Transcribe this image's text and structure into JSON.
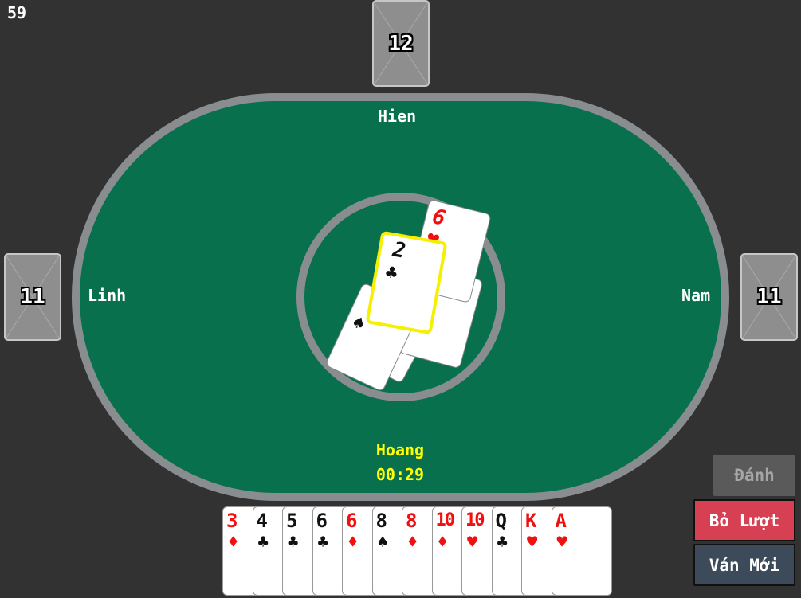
{
  "counter": "59",
  "players": {
    "top": {
      "name": "Hien",
      "cards_left": "12"
    },
    "left": {
      "name": "Linh",
      "cards_left": "11"
    },
    "right": {
      "name": "Nam",
      "cards_left": "11"
    },
    "bottom": {
      "name": "Hoang",
      "timer": "00:29"
    }
  },
  "pile": {
    "played": [
      {
        "rank": "6",
        "suit": "♥",
        "color": "#f01010"
      },
      {
        "rank": "2",
        "suit": "♣",
        "color": "#111111"
      },
      {
        "rank": "",
        "suit": "♠",
        "color": "#111111"
      }
    ],
    "highlight_color": "#f5f000"
  },
  "hand": [
    {
      "rank": "3",
      "suit": "♦",
      "color": "red"
    },
    {
      "rank": "4",
      "suit": "♣",
      "color": "black"
    },
    {
      "rank": "5",
      "suit": "♣",
      "color": "black"
    },
    {
      "rank": "6",
      "suit": "♣",
      "color": "black"
    },
    {
      "rank": "6",
      "suit": "♦",
      "color": "red"
    },
    {
      "rank": "8",
      "suit": "♠",
      "color": "black"
    },
    {
      "rank": "8",
      "suit": "♦",
      "color": "red"
    },
    {
      "rank": "10",
      "suit": "♦",
      "color": "red"
    },
    {
      "rank": "10",
      "suit": "♥",
      "color": "red"
    },
    {
      "rank": "Q",
      "suit": "♣",
      "color": "black"
    },
    {
      "rank": "K",
      "suit": "♥",
      "color": "red"
    },
    {
      "rank": "A",
      "suit": "♥",
      "color": "red"
    }
  ],
  "buttons": {
    "play": "Đánh",
    "pass": "Bỏ Lượt",
    "new_game": "Ván Mới"
  },
  "colors": {
    "background": "#323232",
    "felt": "#08704d",
    "rail": "#8a8d8f",
    "current_player": "#ffff00",
    "pass_button": "#d64052",
    "new_game_button": "#3c4a5a"
  }
}
